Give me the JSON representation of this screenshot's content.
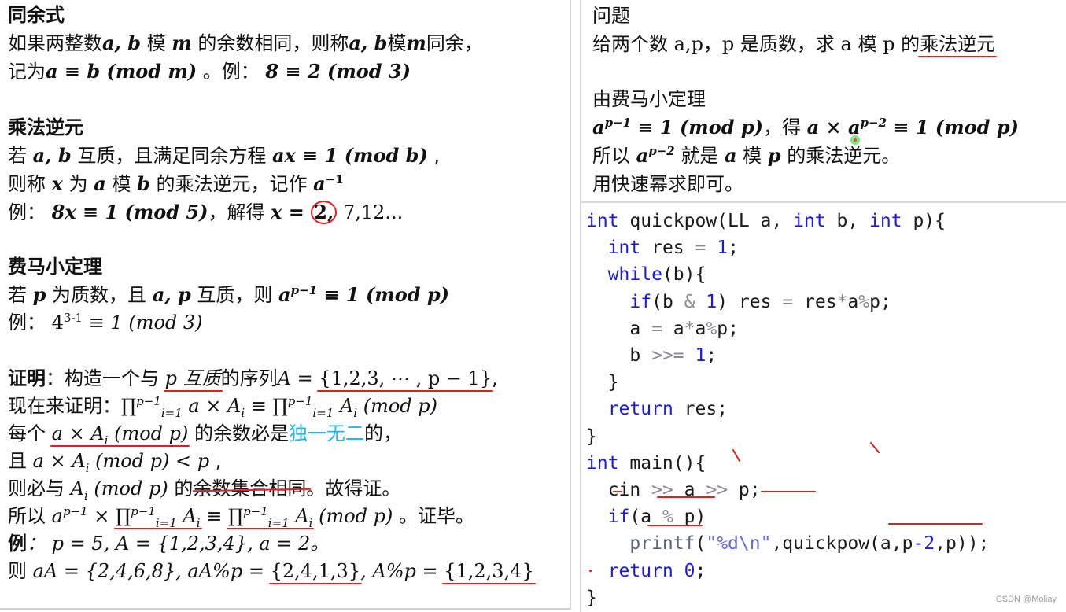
{
  "left": {
    "congruence": {
      "title": "同余式",
      "line1_a": "如果两整数",
      "var_ab": "a, b",
      "line1_b": " 模 ",
      "var_m": "m",
      "line1_c": " 的余数相同，则称",
      "var_ab2": "a, b",
      "line1_d": "模",
      "var_m2": "m",
      "line1_e": "同余，",
      "line2_a": "记为",
      "formula": "a ≡ b (mod m)",
      "line2_b": " 。例：  ",
      "example": "8 ≡ 2 (mod 3)"
    },
    "inverse": {
      "title": "乘法逆元",
      "line1_a": "若 ",
      "var_ab": "a, b",
      "line1_b": " 互质，且满足同余方程 ",
      "equation": "ax ≡ 1 (mod b)",
      "line1_c": " ,",
      "line2_a": "则称 ",
      "var_x": "x",
      "line2_b": " 为 ",
      "var_a": "a",
      "line2_c": " 模 ",
      "var_b": "b",
      "line2_d": " 的乘法逆元，记作 ",
      "notation_base": "a",
      "notation_exp": "−1",
      "line3_a": "例：  ",
      "example_eq": "8x ≡ 1 (mod 5)",
      "line3_b": "，解得 ",
      "solution_var": "x = ",
      "solution_first": "2,",
      "solution_rest": " 7,12..."
    },
    "fermat": {
      "title": "费马小定理",
      "line1_a": "若 ",
      "var_p": "p",
      "line1_b": " 为质数，且 ",
      "var_ap": "a, p",
      "line1_c": " 互质，则 ",
      "theorem_base": "a",
      "theorem_exp": "p−1",
      "theorem_rest": " ≡ 1 (mod p)",
      "line2_a": "例：  ",
      "example_base": "4",
      "example_exp": "3-1",
      "example_rest": " ≡ 1 (mod 3)"
    },
    "proof": {
      "label": "证明",
      "line1_a": "：构造一个与 ",
      "line1_p": "p 互质",
      "line1_b": "的序列",
      "line1_seq_pre": "A = ",
      "line1_seq": "{1,2,3, ⋯ , p − 1}",
      "line1_c": ",",
      "line2_a": "现在来证明：",
      "line2_f1": "∏",
      "line2_sup": "p−1",
      "line2_sub": "i=1",
      "line2_f2": " a × A",
      "line2_i": "i",
      "line2_f3": " ≡ ",
      "line2_f4": "∏",
      "line2_f5": " A",
      "line2_f6": "  (mod p)",
      "line3_a": "每个 ",
      "line3_expr": "a × A",
      "line3_i": "i",
      "line3_mod": " (mod p)",
      "line3_b": " 的余数必是",
      "line3_unique": "独一无二",
      "line3_c": "的，",
      "line4_a": "且 ",
      "line4_expr": "a × A",
      "line4_i": "i",
      "line4_rest": " (mod p) < p ",
      "line4_b": ",",
      "line5_a": "则必与 ",
      "line5_expr": "A",
      "line5_i": "i",
      "line5_mod": " (mod p)",
      "line5_b": " 的",
      "line5_strike": "余数集合相同",
      "line5_c": "。故得证。",
      "line6_a": "所以 ",
      "line6_base": "a",
      "line6_exp": "p−1",
      "line6_times": " × ",
      "line6_prod1": "∏",
      "line6_A": " A",
      "line6_i": "i",
      "line6_eq": " ≡ ",
      "line6_prod2": "∏",
      "line6_mod": "  (mod p)",
      "line6_b": " 。证毕。",
      "ex_label": "例",
      "ex_line1": "：  p = 5, A = {1,2,3,4}, a = 2。",
      "ex_line2_a": "则 ",
      "ex_line2_b": "aA = {2,4,6,8}, aA%p = ",
      "ex_set1": "{2,4,1,3}",
      "ex_line2_c": ", A%p = ",
      "ex_set2": "{1,2,3,4}"
    }
  },
  "right": {
    "problem": {
      "title": "问题",
      "line1_a": "给两个数 a,p，p 是质数，求 a 模 p 的",
      "line1_ul": "乘法逆元"
    },
    "solution": {
      "title": "由费马小定理",
      "line1_base": "a",
      "line1_exp": "p−1",
      "line1_rest": " ≡ 1 (mod p)",
      "line1_mid": "，得 ",
      "line1_f2_a": "a × ",
      "line1_f2_base": "a",
      "line1_f2_exp": "p−2",
      "line1_f2_rest": " ≡ 1 (mod p)",
      "line2_a": "所以 ",
      "line2_base": "a",
      "line2_exp": "p−2",
      "line2_b": " 就是 ",
      "line2_a_var": "a",
      "line2_c": " 模 ",
      "line2_p": "p",
      "line2_d": " 的乘法逆元。",
      "line3": "用快速幂求即可。"
    },
    "code": {
      "l1_kw": "int",
      "l1_a": " quickpow(LL a, ",
      "l1_kw2": "int",
      "l1_b": " b, ",
      "l1_kw3": "int",
      "l1_c": " p){",
      "l2_kw": "int",
      "l2_a": " res ",
      "l2_op": "=",
      "l2_num": "1",
      "l2_b": ";",
      "l3_kw": "while",
      "l3_a": "(b){",
      "l4_kw": "if",
      "l4_a": "(b ",
      "l4_op": "&",
      "l4_num": "1",
      "l4_b": ") res ",
      "l4_op2": "=",
      "l4_c": " res",
      "l4_op3": "*",
      "l4_d": "a",
      "l4_op4": "%",
      "l4_e": "p;",
      "l5_a": "a ",
      "l5_op": "=",
      "l5_b": " a",
      "l5_op2": "*",
      "l5_c": "a",
      "l5_op3": "%",
      "l5_d": "p;",
      "l6_a": "b ",
      "l6_op": ">>=",
      "l6_num": "1",
      "l6_b": ";",
      "l7": "}",
      "l8_kw": "return",
      "l8_a": " res;",
      "l9": "}",
      "l10_kw": "int",
      "l10_a": " main(){",
      "l11_a": "cin ",
      "l11_op": ">>",
      "l11_b": " a ",
      "l11_op2": ">>",
      "l11_c": " p;",
      "l12_kw": "if",
      "l12_a": "(a ",
      "l12_op": "%",
      "l12_b": " p)",
      "l13_fn": "printf",
      "l13_a": "(",
      "l13_str": "\"%d\\n\"",
      "l13_b": ",quickpow(a,p",
      "l13_op": "-",
      "l13_num": "2",
      "l13_c": ",p));",
      "l14_kw": "return",
      "l14_num": "0",
      "l14_a": ";",
      "l15": "}"
    },
    "watermark": "CSDN @Moliay"
  },
  "colors": {
    "keyword": "#1a1ae0",
    "annotation_red": "#e02020",
    "highlight_cyan": "#22b8f0",
    "operator_gray": "#8a8a96"
  }
}
